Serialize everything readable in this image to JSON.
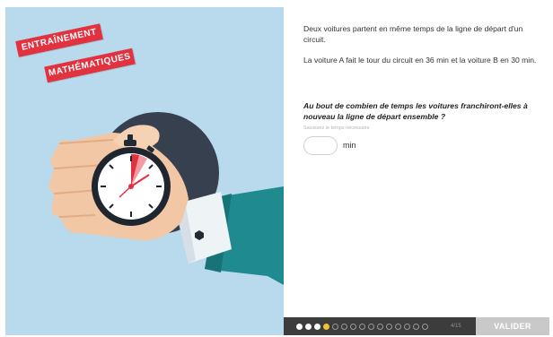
{
  "banner": {
    "line1": "ENTRAÎNEMENT",
    "line2": "MATHÉMATIQUES",
    "color": "#e2313f"
  },
  "illustration": {
    "background": "#b9d9ec",
    "subject": "stopwatch-in-hand"
  },
  "question": {
    "intro": "Deux voitures partent en même temps de la ligne de départ d'un circuit.",
    "facts": "La voiture A fait le tour du circuit en 36 min et la voiture B en 30 min.",
    "prompt": "Au bout de combien de temps les voitures franchiront-elles à nouveau la ligne de départ ensemble ?"
  },
  "answer": {
    "hint": "Saisissez le temps nécessaire",
    "value": "",
    "unit": "min"
  },
  "footer": {
    "total_steps": 15,
    "current_step": 4,
    "counter": "4/15",
    "validate_label": "VALIDER",
    "accent": "#f2c12e"
  }
}
